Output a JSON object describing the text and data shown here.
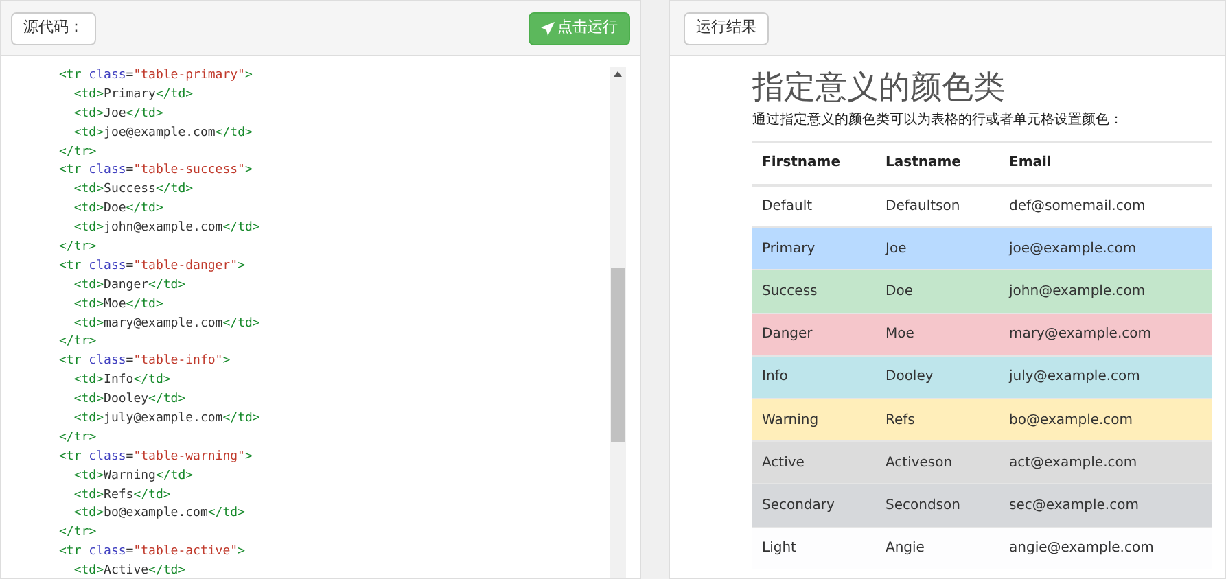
{
  "source_panel": {
    "label_button": "源代码：",
    "run_button": "点击运行",
    "code_lines": [
      "<tr class=\"table-primary\">",
      "  <td>Primary</td>",
      "  <td>Joe</td>",
      "  <td>joe@example.com</td>",
      "</tr>",
      "<tr class=\"table-success\">",
      "  <td>Success</td>",
      "  <td>Doe</td>",
      "  <td>john@example.com</td>",
      "</tr>",
      "<tr class=\"table-danger\">",
      "  <td>Danger</td>",
      "  <td>Moe</td>",
      "  <td>mary@example.com</td>",
      "</tr>",
      "<tr class=\"table-info\">",
      "  <td>Info</td>",
      "  <td>Dooley</td>",
      "  <td>july@example.com</td>",
      "</tr>",
      "<tr class=\"table-warning\">",
      "  <td>Warning</td>",
      "  <td>Refs</td>",
      "  <td>bo@example.com</td>",
      "</tr>",
      "<tr class=\"table-active\">",
      "  <td>Active</td>"
    ]
  },
  "result_panel": {
    "label_button": "运行结果",
    "heading": "指定意义的颜色类",
    "description": "通过指定意义的颜色类可以为表格的行或者单元格设置颜色：",
    "table": {
      "columns": [
        "Firstname",
        "Lastname",
        "Email"
      ],
      "rows": [
        {
          "cells": [
            "Default",
            "Defaultson",
            "def@somemail.com"
          ],
          "color": "#ffffff"
        },
        {
          "cells": [
            "Primary",
            "Joe",
            "joe@example.com"
          ],
          "color": "#b8daff"
        },
        {
          "cells": [
            "Success",
            "Doe",
            "john@example.com"
          ],
          "color": "#c3e6cb"
        },
        {
          "cells": [
            "Danger",
            "Moe",
            "mary@example.com"
          ],
          "color": "#f5c6cb"
        },
        {
          "cells": [
            "Info",
            "Dooley",
            "july@example.com"
          ],
          "color": "#bee5eb"
        },
        {
          "cells": [
            "Warning",
            "Refs",
            "bo@example.com"
          ],
          "color": "#ffeeba"
        },
        {
          "cells": [
            "Active",
            "Activeson",
            "act@example.com"
          ],
          "color": "#dcdcdc"
        },
        {
          "cells": [
            "Secondary",
            "Secondson",
            "sec@example.com"
          ],
          "color": "#d6d8db"
        },
        {
          "cells": [
            "Light",
            "Angie",
            "angie@example.com"
          ],
          "color": "#fdfdfe"
        }
      ]
    }
  }
}
